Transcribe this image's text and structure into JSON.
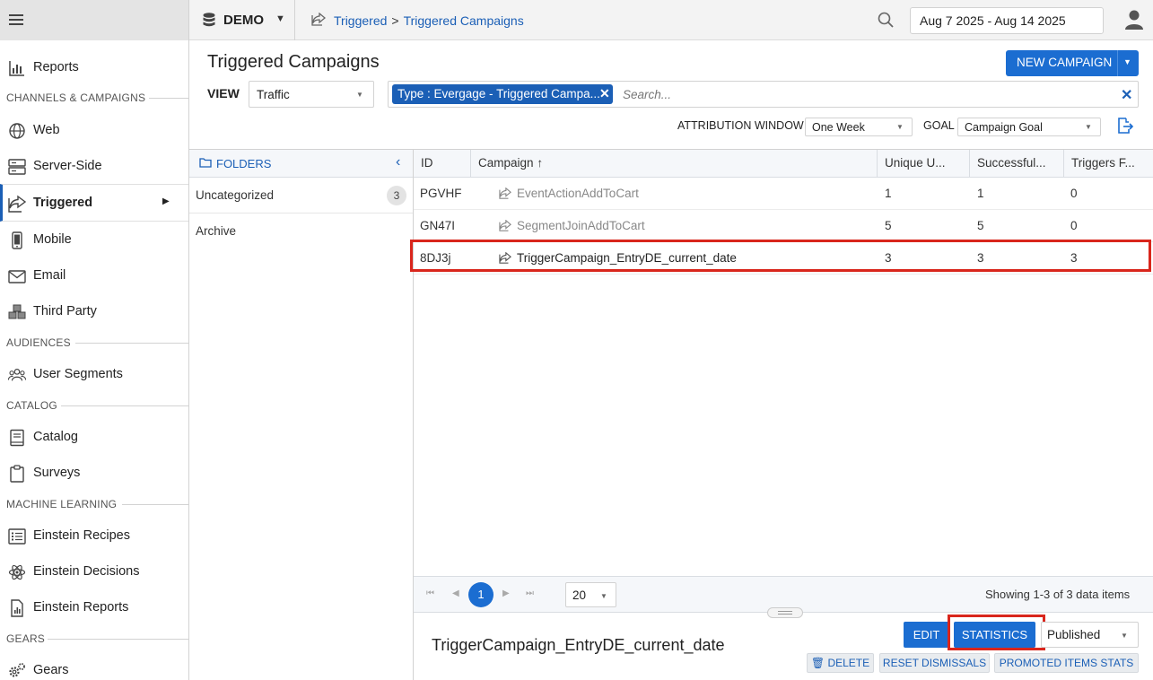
{
  "topbar": {
    "site_name": "DEMO",
    "breadcrumb": [
      "Triggered",
      "Triggered Campaigns"
    ],
    "breadcrumb_sep": ">",
    "date_range": "Aug 7 2025 - Aug 14 2025"
  },
  "sidebar": {
    "items": [
      {
        "label": "Reports",
        "icon": "bar-chart-icon"
      },
      {
        "label": "Web",
        "icon": "globe-icon"
      },
      {
        "label": "Server-Side",
        "icon": "server-icon"
      },
      {
        "label": "Triggered",
        "icon": "share-icon"
      },
      {
        "label": "Mobile",
        "icon": "mobile-icon"
      },
      {
        "label": "Email",
        "icon": "envelope-icon"
      },
      {
        "label": "Third Party",
        "icon": "cubes-icon"
      },
      {
        "label": "User Segments",
        "icon": "users-icon"
      },
      {
        "label": "Catalog",
        "icon": "book-icon"
      },
      {
        "label": "Surveys",
        "icon": "clipboard-icon"
      },
      {
        "label": "Einstein Recipes",
        "icon": "list-icon"
      },
      {
        "label": "Einstein Decisions",
        "icon": "atom-icon"
      },
      {
        "label": "Einstein Reports",
        "icon": "report-file-icon"
      },
      {
        "label": "Gears",
        "icon": "gears-icon"
      }
    ],
    "sections": [
      "CHANNELS & CAMPAIGNS",
      "AUDIENCES",
      "CATALOG",
      "MACHINE LEARNING",
      "GEARS"
    ]
  },
  "main": {
    "title": "Triggered Campaigns",
    "new_campaign_label": "NEW CAMPAIGN",
    "view_label": "VIEW",
    "view_value": "Traffic",
    "filter_chip": "Type : Evergage - Triggered Campa...",
    "search_placeholder": "Search...",
    "attribution_label": "ATTRIBUTION WINDOW",
    "attribution_value": "One Week",
    "goal_label": "GOAL",
    "goal_value": "Campaign Goal"
  },
  "folders": {
    "header": "FOLDERS",
    "items": [
      {
        "name": "Uncategorized",
        "count": "3"
      },
      {
        "name": "Archive",
        "count": ""
      }
    ]
  },
  "grid": {
    "columns": [
      "ID",
      "Campaign",
      "Unique U...",
      "Successful...",
      "Triggers F..."
    ],
    "sort_indicator": "↑",
    "rows": [
      {
        "id": "PGVHF",
        "campaign": "EventActionAddToCart",
        "unique": "1",
        "successful": "1",
        "triggers": "0"
      },
      {
        "id": "GN47I",
        "campaign": "SegmentJoinAddToCart",
        "unique": "5",
        "successful": "5",
        "triggers": "0"
      },
      {
        "id": "8DJ3j",
        "campaign": "TriggerCampaign_EntryDE_current_date",
        "unique": "3",
        "successful": "3",
        "triggers": "3"
      }
    ]
  },
  "pager": {
    "current_page": "1",
    "page_size": "20",
    "info": "Showing 1-3 of 3 data items"
  },
  "detail": {
    "title": "TriggerCampaign_EntryDE_current_date",
    "edit_label": "EDIT",
    "statistics_label": "STATISTICS",
    "status_value": "Published",
    "delete_label": "DELETE",
    "reset_label": "RESET DISMISSALS",
    "promoted_label": "PROMOTED ITEMS STATS"
  },
  "colors": {
    "accent": "#1b6dd1",
    "link": "#1b5fb6",
    "highlight": "#d9261c"
  }
}
